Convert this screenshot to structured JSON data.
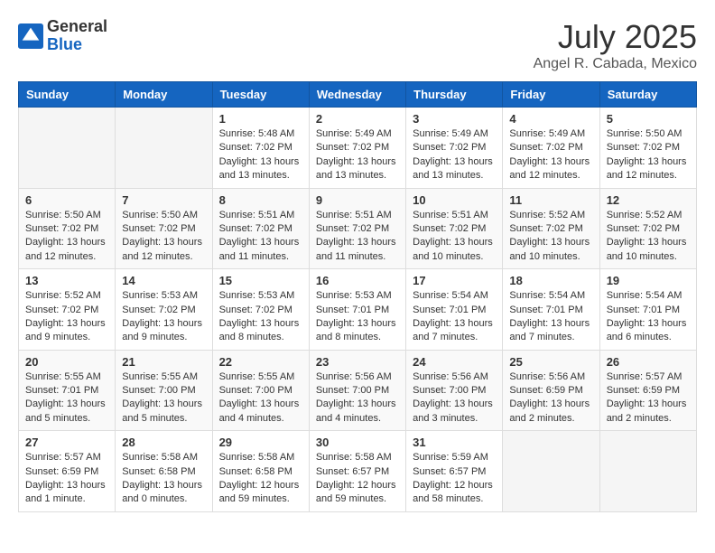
{
  "header": {
    "logo_general": "General",
    "logo_blue": "Blue",
    "title": "July 2025",
    "subtitle": "Angel R. Cabada, Mexico"
  },
  "calendar": {
    "days_of_week": [
      "Sunday",
      "Monday",
      "Tuesday",
      "Wednesday",
      "Thursday",
      "Friday",
      "Saturday"
    ],
    "weeks": [
      [
        {
          "day": "",
          "info": ""
        },
        {
          "day": "",
          "info": ""
        },
        {
          "day": "1",
          "info": "Sunrise: 5:48 AM\nSunset: 7:02 PM\nDaylight: 13 hours\nand 13 minutes."
        },
        {
          "day": "2",
          "info": "Sunrise: 5:49 AM\nSunset: 7:02 PM\nDaylight: 13 hours\nand 13 minutes."
        },
        {
          "day": "3",
          "info": "Sunrise: 5:49 AM\nSunset: 7:02 PM\nDaylight: 13 hours\nand 13 minutes."
        },
        {
          "day": "4",
          "info": "Sunrise: 5:49 AM\nSunset: 7:02 PM\nDaylight: 13 hours\nand 12 minutes."
        },
        {
          "day": "5",
          "info": "Sunrise: 5:50 AM\nSunset: 7:02 PM\nDaylight: 13 hours\nand 12 minutes."
        }
      ],
      [
        {
          "day": "6",
          "info": "Sunrise: 5:50 AM\nSunset: 7:02 PM\nDaylight: 13 hours\nand 12 minutes."
        },
        {
          "day": "7",
          "info": "Sunrise: 5:50 AM\nSunset: 7:02 PM\nDaylight: 13 hours\nand 12 minutes."
        },
        {
          "day": "8",
          "info": "Sunrise: 5:51 AM\nSunset: 7:02 PM\nDaylight: 13 hours\nand 11 minutes."
        },
        {
          "day": "9",
          "info": "Sunrise: 5:51 AM\nSunset: 7:02 PM\nDaylight: 13 hours\nand 11 minutes."
        },
        {
          "day": "10",
          "info": "Sunrise: 5:51 AM\nSunset: 7:02 PM\nDaylight: 13 hours\nand 10 minutes."
        },
        {
          "day": "11",
          "info": "Sunrise: 5:52 AM\nSunset: 7:02 PM\nDaylight: 13 hours\nand 10 minutes."
        },
        {
          "day": "12",
          "info": "Sunrise: 5:52 AM\nSunset: 7:02 PM\nDaylight: 13 hours\nand 10 minutes."
        }
      ],
      [
        {
          "day": "13",
          "info": "Sunrise: 5:52 AM\nSunset: 7:02 PM\nDaylight: 13 hours\nand 9 minutes."
        },
        {
          "day": "14",
          "info": "Sunrise: 5:53 AM\nSunset: 7:02 PM\nDaylight: 13 hours\nand 9 minutes."
        },
        {
          "day": "15",
          "info": "Sunrise: 5:53 AM\nSunset: 7:02 PM\nDaylight: 13 hours\nand 8 minutes."
        },
        {
          "day": "16",
          "info": "Sunrise: 5:53 AM\nSunset: 7:01 PM\nDaylight: 13 hours\nand 8 minutes."
        },
        {
          "day": "17",
          "info": "Sunrise: 5:54 AM\nSunset: 7:01 PM\nDaylight: 13 hours\nand 7 minutes."
        },
        {
          "day": "18",
          "info": "Sunrise: 5:54 AM\nSunset: 7:01 PM\nDaylight: 13 hours\nand 7 minutes."
        },
        {
          "day": "19",
          "info": "Sunrise: 5:54 AM\nSunset: 7:01 PM\nDaylight: 13 hours\nand 6 minutes."
        }
      ],
      [
        {
          "day": "20",
          "info": "Sunrise: 5:55 AM\nSunset: 7:01 PM\nDaylight: 13 hours\nand 5 minutes."
        },
        {
          "day": "21",
          "info": "Sunrise: 5:55 AM\nSunset: 7:00 PM\nDaylight: 13 hours\nand 5 minutes."
        },
        {
          "day": "22",
          "info": "Sunrise: 5:55 AM\nSunset: 7:00 PM\nDaylight: 13 hours\nand 4 minutes."
        },
        {
          "day": "23",
          "info": "Sunrise: 5:56 AM\nSunset: 7:00 PM\nDaylight: 13 hours\nand 4 minutes."
        },
        {
          "day": "24",
          "info": "Sunrise: 5:56 AM\nSunset: 7:00 PM\nDaylight: 13 hours\nand 3 minutes."
        },
        {
          "day": "25",
          "info": "Sunrise: 5:56 AM\nSunset: 6:59 PM\nDaylight: 13 hours\nand 2 minutes."
        },
        {
          "day": "26",
          "info": "Sunrise: 5:57 AM\nSunset: 6:59 PM\nDaylight: 13 hours\nand 2 minutes."
        }
      ],
      [
        {
          "day": "27",
          "info": "Sunrise: 5:57 AM\nSunset: 6:59 PM\nDaylight: 13 hours\nand 1 minute."
        },
        {
          "day": "28",
          "info": "Sunrise: 5:58 AM\nSunset: 6:58 PM\nDaylight: 13 hours\nand 0 minutes."
        },
        {
          "day": "29",
          "info": "Sunrise: 5:58 AM\nSunset: 6:58 PM\nDaylight: 12 hours\nand 59 minutes."
        },
        {
          "day": "30",
          "info": "Sunrise: 5:58 AM\nSunset: 6:57 PM\nDaylight: 12 hours\nand 59 minutes."
        },
        {
          "day": "31",
          "info": "Sunrise: 5:59 AM\nSunset: 6:57 PM\nDaylight: 12 hours\nand 58 minutes."
        },
        {
          "day": "",
          "info": ""
        },
        {
          "day": "",
          "info": ""
        }
      ]
    ]
  }
}
